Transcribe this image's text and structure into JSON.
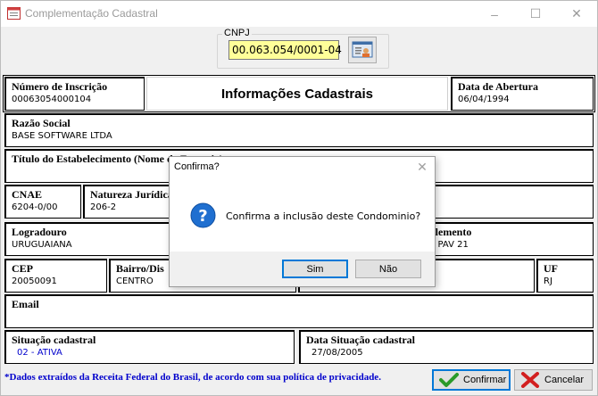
{
  "window": {
    "title": "Complementação Cadastral",
    "controls": {
      "minimize": "–",
      "maximize": "☐",
      "close": "✕"
    }
  },
  "cnpj": {
    "label": "CNPJ",
    "value": "00.063.054/0001-04",
    "lookup_icon": "address-card-icon"
  },
  "header": {
    "title": "Informações Cadastrais"
  },
  "fields": {
    "numero_inscricao": {
      "label": "Número de Inscrição",
      "value": "00063054000104"
    },
    "data_abertura": {
      "label": "Data de Abertura",
      "value": "06/04/1994"
    },
    "razao_social": {
      "label": "Razão Social",
      "value": "BASE SOFTWARE LTDA"
    },
    "titulo_estabelecimento": {
      "label": "Título do Estabelecimento (Nome de Fantasia)",
      "value": ""
    },
    "cnae": {
      "label": "CNAE",
      "value": "6204-0/00"
    },
    "natureza_juridica": {
      "label": "Natureza Jurídica",
      "value": "206-2"
    },
    "logradouro": {
      "label": "Logradouro",
      "value": "URUGUAIANA"
    },
    "complemento": {
      "label": "plemento",
      "value": "2 PAV 21"
    },
    "cep": {
      "label": "CEP",
      "value": "20050091"
    },
    "bairro": {
      "label": "Bairro/Dis",
      "value": "CENTRO"
    },
    "uf": {
      "label": "UF",
      "value": "RJ"
    },
    "email": {
      "label": "Email",
      "value": ""
    },
    "situacao_cadastral": {
      "label": "Situação cadastral",
      "value": "02 - ATIVA"
    },
    "data_situacao": {
      "label": "Data Situação cadastral",
      "value": "27/08/2005"
    }
  },
  "footer": {
    "note": "*Dados extraídos da Receita Federal do Brasil, de acordo com sua política de privacidade.",
    "confirm_label": "Confirmar",
    "cancel_label": "Cancelar"
  },
  "dialog": {
    "title": "Confirma?",
    "close": "✕",
    "message": "Confirma a inclusão deste Condominio?",
    "yes_label": "Sim",
    "no_label": "Não"
  },
  "colors": {
    "accent": "#0078d7",
    "cnpj_bg": "#ffff99",
    "note_blue": "#0000cc"
  }
}
